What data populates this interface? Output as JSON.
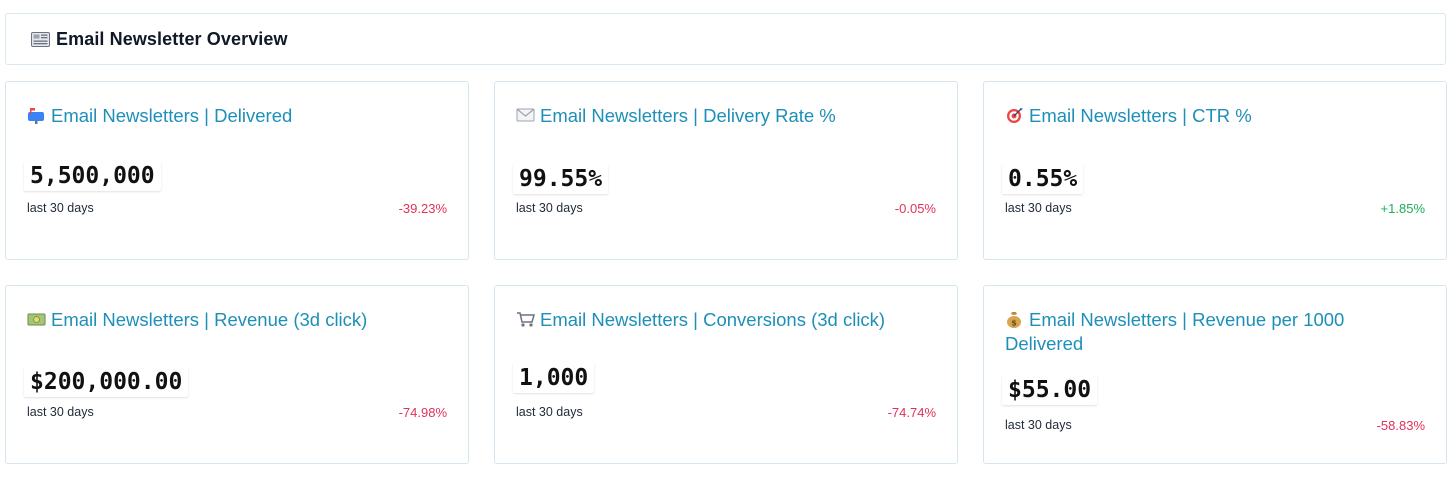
{
  "header": {
    "title": "Email Newsletter Overview",
    "icon": "newspaper-icon"
  },
  "cards": [
    {
      "icon": "mailbox-icon",
      "title": "Email Newsletters | Delivered",
      "value": "5,500,000",
      "period": "last 30 days",
      "delta": "-39.23%",
      "trend": "negative"
    },
    {
      "icon": "envelope-icon",
      "title": "Email Newsletters | Delivery Rate %",
      "value": "99.55%",
      "period": "last 30 days",
      "delta": "-0.05%",
      "trend": "negative"
    },
    {
      "icon": "target-icon",
      "title": "Email Newsletters | CTR %",
      "value": "0.55%",
      "period": "last 30 days",
      "delta": "+1.85%",
      "trend": "positive"
    },
    {
      "icon": "money-bill-icon",
      "title": "Email Newsletters | Revenue (3d click)",
      "value": "$200,000.00",
      "period": "last 30 days",
      "delta": "-74.98%",
      "trend": "negative"
    },
    {
      "icon": "shopping-cart-icon",
      "title": "Email Newsletters | Conversions (3d click)",
      "value": "1,000",
      "period": "last 30 days",
      "delta": "-74.74%",
      "trend": "negative"
    },
    {
      "icon": "money-bag-icon",
      "title": "Email Newsletters | Revenue per 1000 Delivered",
      "value": "$55.00",
      "period": "last 30 days",
      "delta": "-58.83%",
      "trend": "negative"
    }
  ],
  "colors": {
    "title": "#1d8fb8",
    "negative": "#e0325a",
    "positive": "#1fae5b",
    "border": "#d5e6ef"
  }
}
